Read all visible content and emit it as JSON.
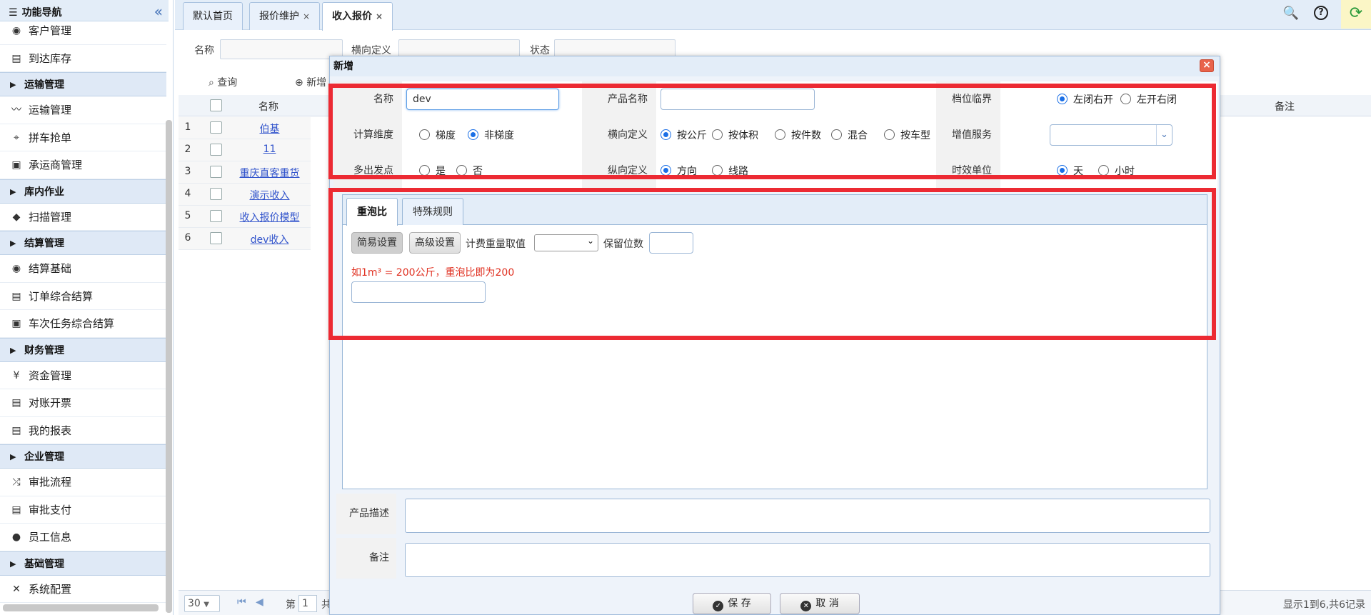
{
  "sidebar": {
    "title": "功能导航",
    "collapse_icon": "double-chevron-left-icon",
    "items": [
      {
        "type": "item",
        "label": "客户管理",
        "icon": "customer-icon"
      },
      {
        "type": "item",
        "label": "到达库存",
        "icon": "document-icon"
      },
      {
        "type": "group",
        "label": "运输管理"
      },
      {
        "type": "item",
        "label": "运输管理",
        "icon": "route-icon"
      },
      {
        "type": "item",
        "label": "拼车抢单",
        "icon": "location-pin-icon"
      },
      {
        "type": "item",
        "label": "承运商管理",
        "icon": "bus-icon"
      },
      {
        "type": "group",
        "label": "库内作业"
      },
      {
        "type": "item",
        "label": "扫描管理",
        "icon": "cube-icon"
      },
      {
        "type": "group",
        "label": "结算管理"
      },
      {
        "type": "item",
        "label": "结算基础",
        "icon": "eye-icon"
      },
      {
        "type": "item",
        "label": "订单综合结算",
        "icon": "document-icon"
      },
      {
        "type": "item",
        "label": "车次任务综合结算",
        "icon": "bus-icon"
      },
      {
        "type": "group",
        "label": "财务管理"
      },
      {
        "type": "item",
        "label": "资金管理",
        "icon": "yen-icon"
      },
      {
        "type": "item",
        "label": "对账开票",
        "icon": "document-icon"
      },
      {
        "type": "item",
        "label": "我的报表",
        "icon": "document-icon"
      },
      {
        "type": "group",
        "label": "企业管理"
      },
      {
        "type": "item",
        "label": "审批流程",
        "icon": "shuffle-icon"
      },
      {
        "type": "item",
        "label": "审批支付",
        "icon": "document-icon"
      },
      {
        "type": "item",
        "label": "员工信息",
        "icon": "user-icon"
      },
      {
        "type": "group",
        "label": "基础管理"
      },
      {
        "type": "item",
        "label": "系统配置",
        "icon": "tools-icon"
      }
    ]
  },
  "tabs": [
    {
      "label": "默认首页",
      "closable": false
    },
    {
      "label": "报价维护",
      "closable": true
    },
    {
      "label": "收入报价",
      "closable": true,
      "active": true
    }
  ],
  "tab_close": "×",
  "filters": {
    "name_label": "名称",
    "horizontal_label": "横向定义",
    "status_label": "状态"
  },
  "toolbar": {
    "query": "查询",
    "add": "新增"
  },
  "grid": {
    "col_name": "名称",
    "col_remark": "备注",
    "rows": [
      {
        "n": "1",
        "name": "伯基"
      },
      {
        "n": "2",
        "name": "11"
      },
      {
        "n": "3",
        "name": "重庆直客重货"
      },
      {
        "n": "4",
        "name": "演示收入"
      },
      {
        "n": "5",
        "name": "收入报价模型"
      },
      {
        "n": "6",
        "name": "dev收入"
      }
    ]
  },
  "pager": {
    "page_size": "30",
    "page_label": "第",
    "page_value": "1",
    "page_suffix": "共",
    "summary": "显示1到6,共6记录"
  },
  "dialog": {
    "title": "新增",
    "close": "×",
    "form": {
      "name_label": "名称",
      "name_value": "dev",
      "product_name_label": "产品名称",
      "product_name_value": "",
      "tier_label": "档位临界",
      "tier_options": [
        "左闭右开",
        "左开右闭"
      ],
      "tier_selected": 0,
      "calc_dim_label": "计算维度",
      "calc_dim_options": [
        "梯度",
        "非梯度"
      ],
      "calc_dim_selected": 1,
      "horizontal_label": "横向定义",
      "horizontal_options": [
        "按公斤",
        "按体积",
        "按件数",
        "混合",
        "按车型"
      ],
      "horizontal_selected": 0,
      "value_added_label": "增值服务",
      "value_added_value": "",
      "multi_origin_label": "多出发点",
      "multi_origin_options": [
        "是",
        "否"
      ],
      "multi_origin_selected": -1,
      "vertical_label": "纵向定义",
      "vertical_options": [
        "方向",
        "线路"
      ],
      "vertical_selected": 0,
      "time_unit_label": "时效单位",
      "time_unit_options": [
        "天",
        "小时"
      ],
      "time_unit_selected": 0
    },
    "inner_tabs": [
      {
        "label": "重泡比",
        "active": true
      },
      {
        "label": "特殊规则",
        "active": false
      }
    ],
    "ratio": {
      "simple_btn": "简易设置",
      "advanced_btn": "高级设置",
      "weight_label": "计费重量取值",
      "weight_value": "",
      "decimal_label": "保留位数",
      "decimal_value": "",
      "hint": "如1m³ = 200公斤，重泡比即为200",
      "ratio_value": ""
    },
    "product_desc_label": "产品描述",
    "remark_label": "备注",
    "save_label": "保 存",
    "cancel_label": "取 消"
  },
  "colors": {
    "highlight": "#ec2a33",
    "accent": "#1a6fe6",
    "link": "#3355cc",
    "hint": "#e03020"
  }
}
